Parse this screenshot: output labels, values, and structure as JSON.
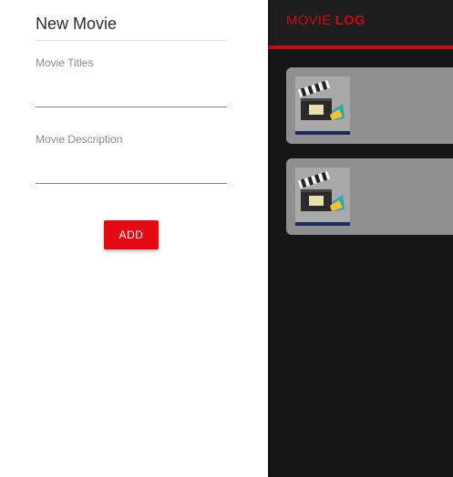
{
  "app": {
    "title_regular": "MOVIE ",
    "title_bold": "LOG",
    "accent_color": "#c50d13",
    "background_color": "#161616"
  },
  "movie_cards": [
    {
      "thumbnail_icon": "clapperboard-icon"
    },
    {
      "thumbnail_icon": "clapperboard-icon"
    }
  ],
  "drawer": {
    "title": "New Movie",
    "fields": [
      {
        "label": "Movie Titles",
        "value": "",
        "placeholder": ""
      },
      {
        "label": "Movie Description",
        "value": "",
        "placeholder": ""
      }
    ],
    "add_button_label": "ADD",
    "add_button_color": "#e50914"
  }
}
